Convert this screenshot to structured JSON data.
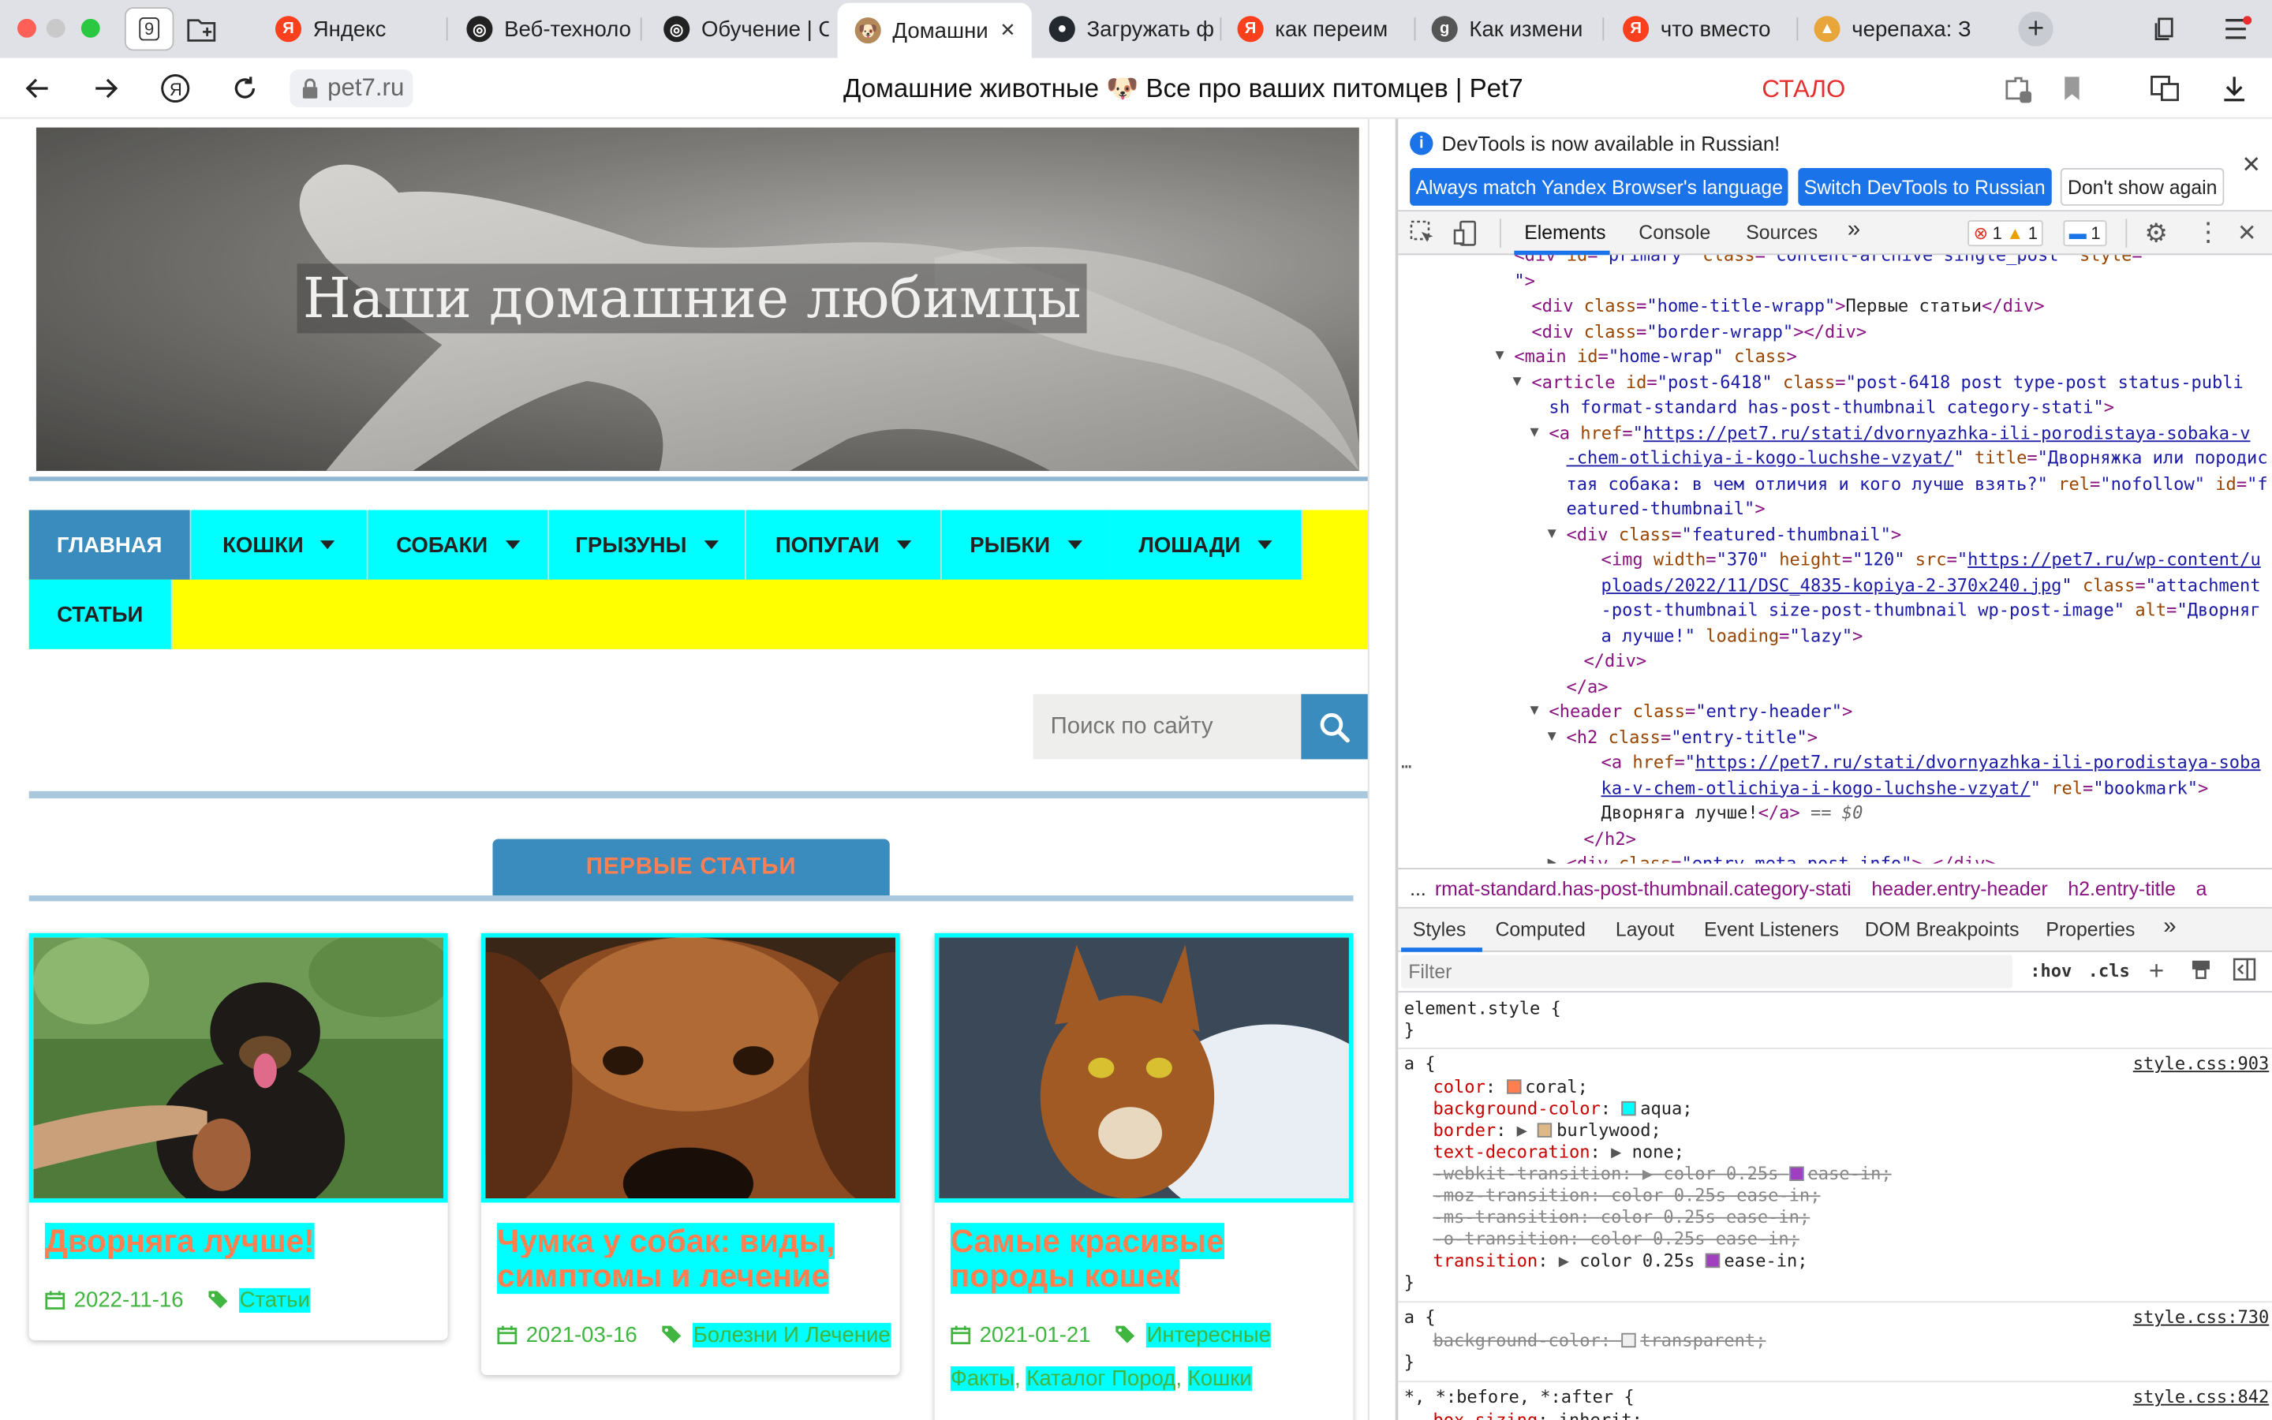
{
  "browser": {
    "tab_count": "9",
    "tabs": [
      {
        "label": "Яндекс",
        "favicon_color": "#fc3f1d",
        "favicon_glyph": "Я"
      },
      {
        "label": "Веб-техноло",
        "favicon_color": "#222222",
        "favicon_glyph": "◎"
      },
      {
        "label": "Обучение | С",
        "favicon_color": "#222222",
        "favicon_glyph": "◎"
      },
      {
        "label": "Домашни",
        "favicon_color": "#b48a5a",
        "favicon_glyph": "🐶",
        "active": true
      },
      {
        "label": "Загружать ф",
        "favicon_color": "#24292f",
        "favicon_glyph": "●"
      },
      {
        "label": "как переим",
        "favicon_color": "#fc3f1d",
        "favicon_glyph": "Я"
      },
      {
        "label": "Как измени",
        "favicon_color": "#555555",
        "favicon_glyph": "g"
      },
      {
        "label": "что вместо",
        "favicon_color": "#fc3f1d",
        "favicon_glyph": "Я"
      },
      {
        "label": "черепаха: З",
        "favicon_color": "#e8a53a",
        "favicon_glyph": "▲"
      }
    ],
    "url": "pet7.ru",
    "page_title": "Домашние животные 🐶  Все про ваших питомцев | Pet7",
    "status_word": "СТАЛО"
  },
  "site": {
    "hero_title": "Наши домашние любимцы",
    "menu": [
      {
        "label": "ГЛАВНАЯ",
        "has_caret": false
      },
      {
        "label": "КОШКИ",
        "has_caret": true
      },
      {
        "label": "СОБАКИ",
        "has_caret": true
      },
      {
        "label": "ГРЫЗУНЫ",
        "has_caret": true
      },
      {
        "label": "ПОПУГАИ",
        "has_caret": true
      },
      {
        "label": "РЫБКИ",
        "has_caret": true
      },
      {
        "label": "ЛОШАДИ",
        "has_caret": true
      },
      {
        "label": "СТАТЬИ",
        "has_caret": false
      }
    ],
    "search_placeholder": "Поиск по сайту",
    "section_heading": "ПЕРВЫЕ СТАТЬИ",
    "cards": [
      {
        "title": "Дворняга лучше!",
        "date": "2022-11-16",
        "tags": [
          "Статьи"
        ]
      },
      {
        "title": "Чумка у собак: виды, симптомы и лечение",
        "date": "2021-03-16",
        "tags": [
          "Болезни И Лечение"
        ]
      },
      {
        "title": "Самые красивые породы кошек",
        "date": "2021-01-21",
        "tags": [
          "Интересные Факты",
          "Каталог Пород",
          "Кошки"
        ]
      }
    ],
    "colors": {
      "link": "#ff7f50",
      "link_bg": "#00ffff",
      "accent": "#3a8bbe",
      "menu_bg": "#ffff00",
      "meta_green": "#40b640"
    }
  },
  "devtools": {
    "notice_text": "DevTools is now available in Russian!",
    "notice_buttons": [
      "Always match Yandex Browser's language",
      "Switch DevTools to Russian",
      "Don't show again"
    ],
    "tabs": [
      "Elements",
      "Console",
      "Sources"
    ],
    "error_count": "1",
    "warning_count": "1",
    "message_count": "1",
    "dom_lines": [
      {
        "indent": 6,
        "tri": "",
        "html": "<span class='t'>&lt;div</span> <span class='an'>id</span>=<span class='av'>\"primary\"</span> <span class='an'>class</span>=<span class='av'>\"content-archive single_post\"</span> <span class='an'>style</span>=<span class='av'>\"</span>"
      },
      {
        "indent": 6,
        "tri": "",
        "html": "<span class='av'>\"</span><span class='t'>&gt;</span>"
      },
      {
        "indent": 7,
        "tri": "",
        "html": "<span class='t'>&lt;div</span> <span class='an'>class</span>=<span class='av'>\"home-title-wrapp\"</span><span class='t'>&gt;</span><span class='tx'>Первые статьи</span><span class='t'>&lt;/div&gt;</span>"
      },
      {
        "indent": 7,
        "tri": "",
        "html": "<span class='t'>&lt;div</span> <span class='an'>class</span>=<span class='av'>\"border-wrapp\"</span><span class='t'>&gt;&lt;/div&gt;</span>"
      },
      {
        "indent": 6,
        "tri": "▼",
        "html": "<span class='t'>&lt;main</span> <span class='an'>id</span>=<span class='av'>\"home-wrap\"</span> <span class='an'>class</span><span class='t'>&gt;</span>"
      },
      {
        "indent": 7,
        "tri": "▼",
        "html": "<span class='t'>&lt;article</span> <span class='an'>id</span>=<span class='av'>\"post-6418\"</span> <span class='an'>class</span>=<span class='av'>\"post-6418 post type-post status-publi</span>"
      },
      {
        "indent": 8,
        "tri": "",
        "html": "<span class='av'>sh format-standard has-post-thumbnail category-stati\"</span><span class='t'>&gt;</span>"
      },
      {
        "indent": 8,
        "tri": "▼",
        "html": "<span class='t'>&lt;a</span> <span class='an'>href</span>=<span class='av'>\"</span><span class='lk'>https://pet7.ru/stati/dvornyazhka-ili-porodistaya-sobaka-v</span>"
      },
      {
        "indent": 9,
        "tri": "",
        "html": "<span class='lk'>-chem-otlichiya-i-kogo-luchshe-vzyat/</span><span class='av'>\"</span> <span class='an'>title</span>=<span class='av'>\"Дворняжка или породис</span>"
      },
      {
        "indent": 9,
        "tri": "",
        "html": "<span class='av'>тая собака: в чем отличия и кого лучше взять?\"</span> <span class='an'>rel</span>=<span class='av'>\"nofollow\"</span> <span class='an'>id</span>=<span class='av'>\"f</span>"
      },
      {
        "indent": 9,
        "tri": "",
        "html": "<span class='av'>eatured-thumbnail\"</span><span class='t'>&gt;</span>"
      },
      {
        "indent": 9,
        "tri": "▼",
        "html": "<span class='t'>&lt;div</span> <span class='an'>class</span>=<span class='av'>\"featured-thumbnail\"</span><span class='t'>&gt;</span>"
      },
      {
        "indent": 11,
        "tri": "",
        "html": "<span class='t'>&lt;img</span> <span class='an'>width</span>=<span class='av'>\"370\"</span> <span class='an'>height</span>=<span class='av'>\"120\"</span> <span class='an'>src</span>=<span class='av'>\"</span><span class='lk'>https://pet7.ru/wp-content/u</span>"
      },
      {
        "indent": 11,
        "tri": "",
        "html": "<span class='lk'>ploads/2022/11/DSC_4835-kopiya-2-370x240.jpg</span><span class='av'>\"</span> <span class='an'>class</span>=<span class='av'>\"attachment</span>"
      },
      {
        "indent": 11,
        "tri": "",
        "html": "<span class='av'>-post-thumbnail size-post-thumbnail wp-post-image\"</span> <span class='an'>alt</span>=<span class='av'>\"Дворняг</span>"
      },
      {
        "indent": 11,
        "tri": "",
        "html": "<span class='av'>а лучше!\"</span> <span class='an'>loading</span>=<span class='av'>\"lazy\"</span><span class='t'>&gt;</span>"
      },
      {
        "indent": 10,
        "tri": "",
        "html": "<span class='t'>&lt;/div&gt;</span>"
      },
      {
        "indent": 9,
        "tri": "",
        "html": "<span class='t'>&lt;/a&gt;</span>"
      },
      {
        "indent": 8,
        "tri": "▼",
        "html": "<span class='t'>&lt;header</span> <span class='an'>class</span>=<span class='av'>\"entry-header\"</span><span class='t'>&gt;</span>"
      },
      {
        "indent": 9,
        "tri": "▼",
        "html": "<span class='t'>&lt;h2</span> <span class='an'>class</span>=<span class='av'>\"entry-title\"</span><span class='t'>&gt;</span>"
      },
      {
        "indent": 11,
        "tri": "",
        "sel": true,
        "html": "<span class='t'>&lt;a</span> <span class='an'>href</span>=<span class='av'>\"</span><span class='lk'>https://pet7.ru/stati/dvornyazhka-ili-porodistaya-soba</span>"
      },
      {
        "indent": 11,
        "tri": "",
        "sel": true,
        "html": "<span class='lk'>ka-v-chem-otlichiya-i-kogo-luchshe-vzyat/</span><span class='av'>\"</span> <span class='an'>rel</span>=<span class='av'>\"bookmark\"</span><span class='t'>&gt;</span>"
      },
      {
        "indent": 11,
        "tri": "",
        "sel": true,
        "html": "<span class='tx'>Дворняга лучше!</span><span class='t'>&lt;/a&gt;</span> <span class='gr'>== $0</span>"
      },
      {
        "indent": 10,
        "tri": "",
        "html": "<span class='t'>&lt;/h2&gt;</span>"
      },
      {
        "indent": 9,
        "tri": "▶",
        "html": "<span class='t'>&lt;div</span> <span class='an'>class</span>=<span class='av'>\"entry-meta post-info\"</span><span class='t'>&gt;</span><span class='tx'>…</span><span class='t'>&lt;/div&gt;</span>"
      }
    ],
    "breadcrumbs": [
      "...",
      "rmat-standard.has-post-thumbnail.category-stati",
      "header.entry-header",
      "h2.entry-title",
      "a"
    ],
    "sub_tabs": [
      "Styles",
      "Computed",
      "Layout",
      "Event Listeners",
      "DOM Breakpoints",
      "Properties"
    ],
    "filter_placeholder": "Filter",
    "hov": ":hov",
    "cls": ".cls",
    "styles": {
      "element_style": "element.style {",
      "rule1_selector": "a {",
      "rule1_source": "style.css:903",
      "rule2_selector": "a {",
      "rule2_source": "style.css:730",
      "rule3_selector": "*, *:before, *:after {",
      "rule3_source": "style.css:842",
      "close": "}"
    }
  }
}
